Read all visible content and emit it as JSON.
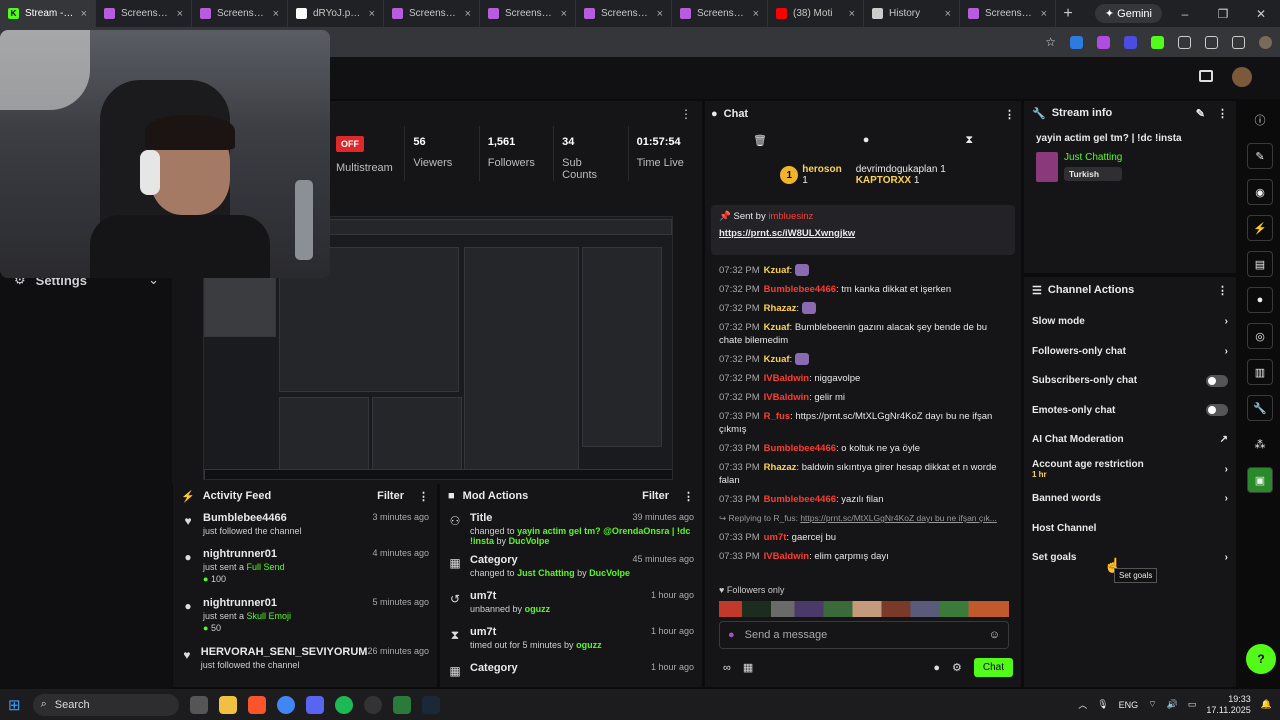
{
  "browser": {
    "tabs": [
      {
        "label": "Stream - Kick",
        "color": "#53fc18",
        "icon": "K"
      },
      {
        "label": "Screenshot by",
        "color": "#b85de0",
        "icon": ""
      },
      {
        "label": "Screenshot by",
        "color": "#b85de0",
        "icon": ""
      },
      {
        "label": "dRYoJ.png (5",
        "color": "#ffffff",
        "icon": ""
      },
      {
        "label": "Screenshot by",
        "color": "#b85de0",
        "icon": ""
      },
      {
        "label": "Screenshot by",
        "color": "#b85de0",
        "icon": ""
      },
      {
        "label": "Screenshot by",
        "color": "#b85de0",
        "icon": ""
      },
      {
        "label": "Screenshot by",
        "color": "#b85de0",
        "icon": ""
      },
      {
        "label": "(38) Moti",
        "color": "#ff0000",
        "icon": ""
      },
      {
        "label": "History",
        "color": "#cccccc",
        "icon": ""
      },
      {
        "label": "Screenshot by",
        "color": "#b85de0",
        "icon": ""
      }
    ],
    "gemini": "Gemini"
  },
  "settings": {
    "label": "Settings"
  },
  "stats": {
    "off": "OFF",
    "multistream": "Multistream",
    "items": [
      {
        "value": "56",
        "label": "Viewers"
      },
      {
        "value": "1,561",
        "label": "Followers"
      },
      {
        "value": "34",
        "label": "Sub Counts"
      },
      {
        "value": "01:57:54",
        "label": "Time Live"
      }
    ]
  },
  "activity": {
    "title": "Activity Feed",
    "filter": "Filter",
    "rows": [
      {
        "name": "Bumblebee4466",
        "time": "3 minutes ago",
        "line": "just followed the channel",
        "extra": ""
      },
      {
        "name": "nightrunner01",
        "time": "4 minutes ago",
        "line": "just sent a",
        "item": "Full Send",
        "extra": "100"
      },
      {
        "name": "nightrunner01",
        "time": "5 minutes ago",
        "line": "just sent a",
        "item": "Skull Emoji",
        "extra": "50"
      },
      {
        "name": "HERVORAH_SENI_SEVIYORUM",
        "time": "26 minutes ago",
        "line": "just followed the channel",
        "extra": ""
      }
    ]
  },
  "mod": {
    "title": "Mod Actions",
    "filter": "Filter",
    "rows": [
      {
        "name": "Title",
        "time": "39 minutes ago",
        "l1": "changed to",
        "v": "yayin actim gel tm? @OrendaOnsra | !dc !insta",
        "by": "by",
        "who": "DucVolpe"
      },
      {
        "name": "Category",
        "time": "45 minutes ago",
        "l1": "changed to",
        "v": "Just Chatting",
        "by": "by",
        "who": "DucVolpe"
      },
      {
        "name": "um7t",
        "time": "1 hour ago",
        "l1": "unbanned by",
        "v": "",
        "by": "",
        "who": "oguzz"
      },
      {
        "name": "um7t",
        "time": "1 hour ago",
        "l1": "timed out for 5 minutes by",
        "v": "",
        "by": "",
        "who": "oguzz"
      },
      {
        "name": "Category",
        "time": "1 hour ago",
        "l1": "",
        "v": "",
        "by": "",
        "who": ""
      }
    ]
  },
  "chat": {
    "title": "Chat",
    "top": [
      {
        "rank": "1",
        "name": "heroson",
        "count": "1"
      },
      {
        "name": "devrimdogukaplan",
        "count": "1"
      },
      {
        "name": "KAPTORXX",
        "count": "1"
      }
    ],
    "pinned": {
      "sent_by": "Sent by",
      "user": "imbluesinz",
      "link": "https://prnt.sc/iW8ULXwngjkw"
    },
    "messages": [
      {
        "time": "07:32 PM",
        "user": "Kzuaf",
        "ucolor": "#ffd34a",
        "text": ""
      },
      {
        "time": "07:32 PM",
        "user": "Bumblebee4466",
        "ucolor": "#ff3b30",
        "text": "tm kanka dikkat et işerken"
      },
      {
        "time": "07:32 PM",
        "user": "Rhazaz",
        "ucolor": "#ffd34a",
        "text": ""
      },
      {
        "time": "07:32 PM",
        "user": "Kzuaf",
        "ucolor": "#ffd34a",
        "text": "Bumblebeenin gazını alacak şey bende de bu chate bilemedim"
      },
      {
        "time": "07:32 PM",
        "user": "Kzuaf",
        "ucolor": "#ffd34a",
        "text": ""
      },
      {
        "time": "07:32 PM",
        "user": "IVBaldwin",
        "ucolor": "#ff3b30",
        "text": "niggavolpe"
      },
      {
        "time": "07:32 PM",
        "user": "IVBaldwin",
        "ucolor": "#ff3b30",
        "text": "gelir mi"
      },
      {
        "time": "07:33 PM",
        "user": "R_fus",
        "ucolor": "#ff3b30",
        "text": "https://prnt.sc/MtXLGgNr4KoZ dayı bu ne ifşan çıkmış"
      },
      {
        "time": "07:33 PM",
        "user": "Bumblebee4466",
        "ucolor": "#ff3b30",
        "text": "o koltuk ne ya öyle"
      },
      {
        "time": "07:33 PM",
        "user": "Rhazaz",
        "ucolor": "#ffd34a",
        "text": "baldwin sıkıntıya girer hesap dikkat et n worde falan"
      },
      {
        "time": "07:33 PM",
        "user": "Bumblebee4466",
        "ucolor": "#ff3b30",
        "text": "yazılı filan"
      },
      {
        "time": "07:33 PM",
        "user": "um7t",
        "ucolor": "#ff3b30",
        "text": "gaercej bu"
      },
      {
        "time": "07:33 PM",
        "user": "IVBaldwin",
        "ucolor": "#ff3b30",
        "text": "elim çarpmış dayı"
      }
    ],
    "reply": "Replying to R_fus:",
    "reply_text": "https://prnt.sc/MtXLGgNr4KoZ dayı bu ne ifşan çık...",
    "followers_only": "Followers only",
    "placeholder": "Send a message",
    "send": "Chat"
  },
  "stream_info": {
    "title": "Stream info",
    "stream_title": "yayin actim gel tm? | !dc !insta",
    "category": "Just Chatting",
    "tag": "Turkish"
  },
  "channel_actions": {
    "title": "Channel Actions",
    "items": [
      {
        "label": "Slow mode",
        "kind": "arrow"
      },
      {
        "label": "Followers-only chat",
        "kind": "arrow"
      },
      {
        "label": "Subscribers-only chat",
        "kind": "toggle"
      },
      {
        "label": "Emotes-only chat",
        "kind": "toggle"
      },
      {
        "label": "AI Chat Moderation",
        "kind": "ext"
      },
      {
        "label": "Account age restriction",
        "sub": "1 hr",
        "kind": "arrow"
      },
      {
        "label": "Banned words",
        "kind": "arrow"
      },
      {
        "label": "Host Channel",
        "kind": "none"
      },
      {
        "label": "Set goals",
        "kind": "arrow"
      }
    ],
    "tooltip": "Set goals"
  },
  "taskbar": {
    "search": "Search",
    "lang": "ENG",
    "time": "19:33",
    "date": "17.11.2025"
  }
}
